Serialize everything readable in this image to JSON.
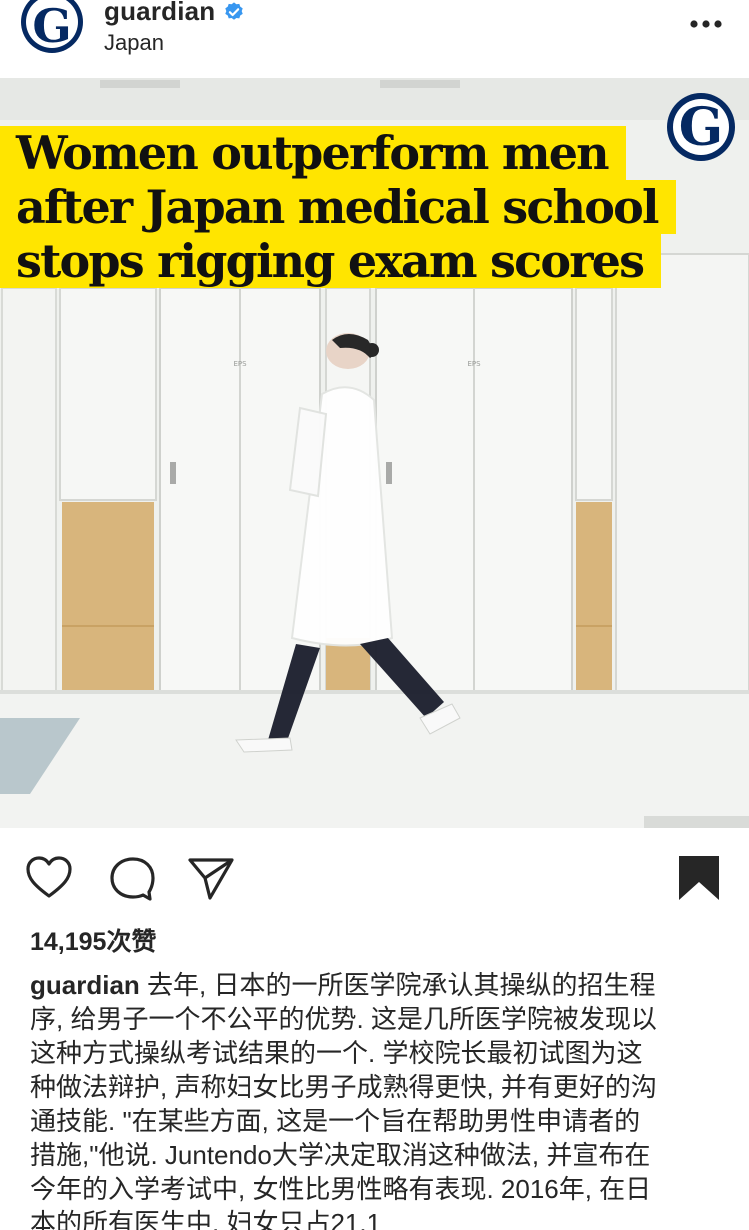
{
  "header": {
    "account_name": "guardian",
    "location": "Japan",
    "avatar_letter": "G",
    "verified_icon": "verified-badge-icon",
    "more_icon": "more-options-icon"
  },
  "image": {
    "headline_lines": [
      "Women outperform men",
      "after Japan medical school",
      "stops rigging exam scores"
    ],
    "door_labels": [
      "EPS",
      "EPS"
    ],
    "badge_letter": "G",
    "colors": {
      "headline_bg": "#ffe500",
      "brand": "#052962"
    }
  },
  "actions": {
    "like_icon": "heart-icon",
    "comment_icon": "comment-icon",
    "share_icon": "send-icon",
    "save_icon": "bookmark-icon",
    "likes_text": "14,195次赞"
  },
  "caption": {
    "user": "guardian",
    "lines": [
      " 去年, 日本的一所医学院承认其操纵的招生程",
      "序, 给男子一个不公平的优势. 这是几所医学院被发现以",
      "这种方式操纵考试结果的一个. 学校院长最初试图为这",
      "种做法辩护, 声称妇女比男子成熟得更快, 并有更好的沟",
      "通技能. \"在某些方面, 这是一个旨在帮助男性申请者的",
      "措施,\"他说. Juntendo大学决定取消这种做法, 并宣布在",
      "今年的入学考试中, 女性比男性略有表现. 2016年, 在日",
      "本的所有医生中, 妇女只占21.1"
    ]
  }
}
